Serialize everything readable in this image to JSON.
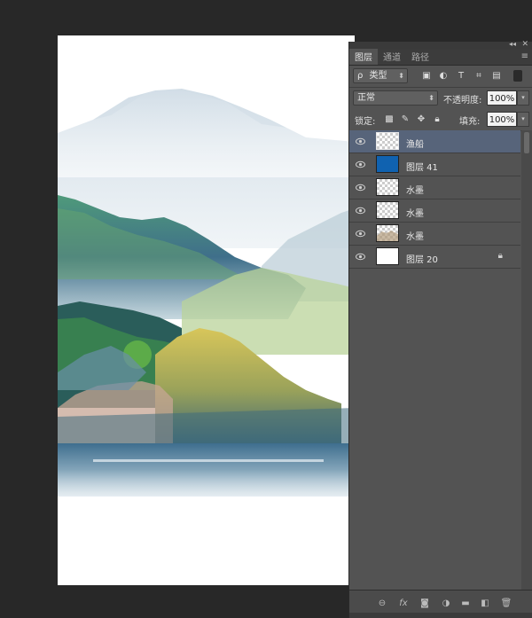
{
  "panel": {
    "tabs": [
      {
        "label": "图层",
        "active": true
      },
      {
        "label": "通道",
        "active": false
      },
      {
        "label": "路径",
        "active": false
      }
    ],
    "filter": {
      "search_glyph": "ρ",
      "kind_label": "类型"
    },
    "blend_mode": "正常",
    "opacity_label": "不透明度:",
    "opacity_value": "100%",
    "lock_label": "锁定:",
    "fill_label": "填充:",
    "fill_value": "100%",
    "layers": [
      {
        "name": "渔船",
        "thumb": "transparent",
        "selected": true,
        "locked": false
      },
      {
        "name": "图层 41",
        "thumb": "#1062b0",
        "selected": false,
        "locked": false
      },
      {
        "name": "水墨",
        "thumb": "transparent",
        "selected": false,
        "locked": false
      },
      {
        "name": "水墨",
        "thumb": "transparent",
        "selected": false,
        "locked": false
      },
      {
        "name": "水墨",
        "thumb": "transparent-ink",
        "selected": false,
        "locked": false
      },
      {
        "name": "图层 20",
        "thumb": "#ffffff",
        "selected": false,
        "locked": true
      }
    ],
    "bottom_icons": [
      "link-icon",
      "fx-icon",
      "mask-icon",
      "adjustment-icon",
      "folder-icon",
      "new-layer-icon",
      "trash-icon"
    ],
    "fx_label": "fx"
  },
  "colors": {
    "workspace": "#282828",
    "panel_bg": "#535353",
    "selected_row": "#57647a",
    "layer41_fill": "#1062b0"
  }
}
